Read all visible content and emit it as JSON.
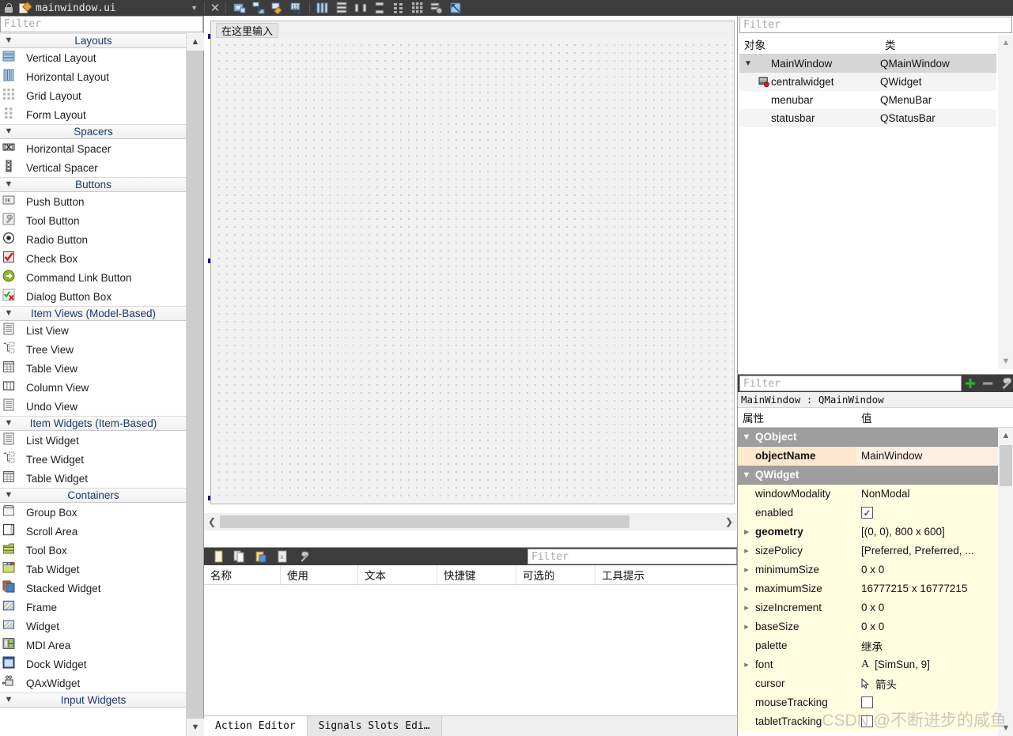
{
  "titlebar": {
    "filename": "mainwindow.ui",
    "lock_icon": "lock-icon",
    "doc_icon": "document-edit-icon",
    "dropdown_icon": "chevron-down-icon",
    "close_icon": "close-icon",
    "tools": [
      {
        "name": "edit-widgets-icon"
      },
      {
        "name": "edit-signals-slots-icon"
      },
      {
        "name": "edit-buddies-icon"
      },
      {
        "name": "edit-tab-order-icon"
      },
      {
        "name": "layout-horizontally-icon"
      },
      {
        "name": "layout-vertically-icon"
      },
      {
        "name": "layout-splitter-horizontal-icon"
      },
      {
        "name": "layout-splitter-vertical-icon"
      },
      {
        "name": "layout-form-icon"
      },
      {
        "name": "layout-grid-icon"
      },
      {
        "name": "break-layout-icon"
      },
      {
        "name": "adjust-size-icon"
      }
    ]
  },
  "widgetbox": {
    "filter_placeholder": "Filter",
    "scroll_up_icon": "chevron-up-icon",
    "scroll_down_icon": "chevron-down-icon",
    "sections": [
      {
        "title": "Layouts",
        "items": [
          {
            "label": "Vertical Layout",
            "icon": "vertical-layout-icon"
          },
          {
            "label": "Horizontal Layout",
            "icon": "horizontal-layout-icon"
          },
          {
            "label": "Grid Layout",
            "icon": "grid-layout-icon"
          },
          {
            "label": "Form Layout",
            "icon": "form-layout-icon"
          }
        ]
      },
      {
        "title": "Spacers",
        "items": [
          {
            "label": "Horizontal Spacer",
            "icon": "horizontal-spacer-icon"
          },
          {
            "label": "Vertical Spacer",
            "icon": "vertical-spacer-icon"
          }
        ]
      },
      {
        "title": "Buttons",
        "items": [
          {
            "label": "Push Button",
            "icon": "push-button-icon"
          },
          {
            "label": "Tool Button",
            "icon": "tool-button-icon"
          },
          {
            "label": "Radio Button",
            "icon": "radio-button-icon"
          },
          {
            "label": "Check Box",
            "icon": "check-box-icon"
          },
          {
            "label": "Command Link Button",
            "icon": "command-link-button-icon"
          },
          {
            "label": "Dialog Button Box",
            "icon": "dialog-button-box-icon"
          }
        ]
      },
      {
        "title": "Item Views (Model-Based)",
        "items": [
          {
            "label": "List View",
            "icon": "list-view-icon"
          },
          {
            "label": "Tree View",
            "icon": "tree-view-icon"
          },
          {
            "label": "Table View",
            "icon": "table-view-icon"
          },
          {
            "label": "Column View",
            "icon": "column-view-icon"
          },
          {
            "label": "Undo View",
            "icon": "undo-view-icon"
          }
        ]
      },
      {
        "title": "Item Widgets (Item-Based)",
        "items": [
          {
            "label": "List Widget",
            "icon": "list-widget-icon"
          },
          {
            "label": "Tree Widget",
            "icon": "tree-widget-icon"
          },
          {
            "label": "Table Widget",
            "icon": "table-widget-icon"
          }
        ]
      },
      {
        "title": "Containers",
        "items": [
          {
            "label": "Group Box",
            "icon": "group-box-icon"
          },
          {
            "label": "Scroll Area",
            "icon": "scroll-area-icon"
          },
          {
            "label": "Tool Box",
            "icon": "tool-box-icon"
          },
          {
            "label": "Tab Widget",
            "icon": "tab-widget-icon"
          },
          {
            "label": "Stacked Widget",
            "icon": "stacked-widget-icon"
          },
          {
            "label": "Frame",
            "icon": "frame-icon"
          },
          {
            "label": "Widget",
            "icon": "widget-icon"
          },
          {
            "label": "MDI Area",
            "icon": "mdi-area-icon"
          },
          {
            "label": "Dock Widget",
            "icon": "dock-widget-icon"
          },
          {
            "label": "QAxWidget",
            "icon": "qaxwidget-icon"
          }
        ]
      },
      {
        "title": "Input Widgets",
        "items": []
      }
    ]
  },
  "canvas": {
    "menubar_typehere": "在这里输入",
    "scroll_left_icon": "chevron-left-icon",
    "scroll_right_icon": "chevron-right-icon"
  },
  "action_editor": {
    "filter_placeholder": "Filter",
    "tools": [
      {
        "name": "new-action-icon"
      },
      {
        "name": "copy-action-icon"
      },
      {
        "name": "paste-action-icon"
      },
      {
        "name": "delete-action-icon"
      },
      {
        "name": "configure-view-icon"
      }
    ],
    "columns": [
      "名称",
      "使用",
      "文本",
      "快捷键",
      "可选的",
      "工具提示"
    ],
    "rows": [],
    "tabs": [
      {
        "label": "Action Editor",
        "active": true
      },
      {
        "label": "Signals  Slots Edi…",
        "active": false
      }
    ]
  },
  "object_inspector": {
    "filter_placeholder": "Filter",
    "columns": [
      "对象",
      "类"
    ],
    "scroll_up_icon": "chevron-up-icon",
    "scroll_down_icon": "chevron-down-icon",
    "rows": [
      {
        "name": "MainWindow",
        "class": "QMainWindow",
        "indent": 0,
        "expander": "chevron-down-icon",
        "icon": "",
        "selected": true
      },
      {
        "name": "centralwidget",
        "class": "QWidget",
        "indent": 1,
        "expander": "",
        "icon": "central-widget-icon",
        "selected": false
      },
      {
        "name": "menubar",
        "class": "QMenuBar",
        "indent": 1,
        "expander": "",
        "icon": "",
        "selected": false
      },
      {
        "name": "statusbar",
        "class": "QStatusBar",
        "indent": 1,
        "expander": "",
        "icon": "",
        "selected": false
      }
    ]
  },
  "property_editor": {
    "filter_placeholder": "Filter",
    "add_icon": "plus-icon",
    "remove_icon": "minus-icon",
    "configure_icon": "wrench-icon",
    "object_line": "MainWindow : QMainWindow",
    "columns": [
      "属性",
      "值"
    ],
    "scroll_up_icon": "chevron-up-icon",
    "scroll_down_icon": "chevron-down-icon",
    "rows": [
      {
        "kind": "group",
        "key": "QObject",
        "value": "",
        "expander": "chevron-down-icon"
      },
      {
        "kind": "prop",
        "key": "objectName",
        "value": "MainWindow",
        "expander": "",
        "bold": true,
        "tint": "orange"
      },
      {
        "kind": "group",
        "key": "QWidget",
        "value": "",
        "expander": "chevron-down-icon"
      },
      {
        "kind": "prop",
        "key": "windowModality",
        "value": "NonModal",
        "expander": "",
        "bold": false,
        "tint": "yellow"
      },
      {
        "kind": "prop",
        "key": "enabled",
        "value": "",
        "expander": "",
        "bold": false,
        "tint": "yellow",
        "widget": "checkbox-checked"
      },
      {
        "kind": "prop",
        "key": "geometry",
        "value": "[(0, 0), 800 x 600]",
        "expander": "chevron-right-icon",
        "bold": true,
        "tint": "yellow"
      },
      {
        "kind": "prop",
        "key": "sizePolicy",
        "value": "[Preferred, Preferred, ...",
        "expander": "chevron-right-icon",
        "bold": false,
        "tint": "yellow"
      },
      {
        "kind": "prop",
        "key": "minimumSize",
        "value": "0 x 0",
        "expander": "chevron-right-icon",
        "bold": false,
        "tint": "yellow"
      },
      {
        "kind": "prop",
        "key": "maximumSize",
        "value": "16777215 x 16777215",
        "expander": "chevron-right-icon",
        "bold": false,
        "tint": "yellow"
      },
      {
        "kind": "prop",
        "key": "sizeIncrement",
        "value": "0 x 0",
        "expander": "chevron-right-icon",
        "bold": false,
        "tint": "yellow"
      },
      {
        "kind": "prop",
        "key": "baseSize",
        "value": "0 x 0",
        "expander": "chevron-right-icon",
        "bold": false,
        "tint": "yellow"
      },
      {
        "kind": "prop",
        "key": "palette",
        "value": "继承",
        "expander": "",
        "bold": false,
        "tint": "yellow"
      },
      {
        "kind": "prop",
        "key": "font",
        "value": "[SimSun, 9]",
        "expander": "chevron-right-icon",
        "bold": false,
        "tint": "yellow",
        "widget": "font-glyph"
      },
      {
        "kind": "prop",
        "key": "cursor",
        "value": "箭头",
        "expander": "",
        "bold": false,
        "tint": "yellow",
        "widget": "cursor-glyph"
      },
      {
        "kind": "prop",
        "key": "mouseTracking",
        "value": "",
        "expander": "",
        "bold": false,
        "tint": "yellow",
        "widget": "checkbox-unchecked"
      },
      {
        "kind": "prop",
        "key": "tabletTracking",
        "value": "",
        "expander": "",
        "bold": false,
        "tint": "yellow",
        "widget": "checkbox-unchecked"
      }
    ]
  },
  "watermark": "CSDN @不断进步的咸鱼",
  "colors": {
    "chrome": "#3c3c3c",
    "selection": "#d6d6d6",
    "group_header": "#9e9e9e",
    "prop_yellow": "#fffde0",
    "prop_orange": "#fde7cd",
    "handle": "#10106a",
    "accent_green": "#35b035"
  }
}
